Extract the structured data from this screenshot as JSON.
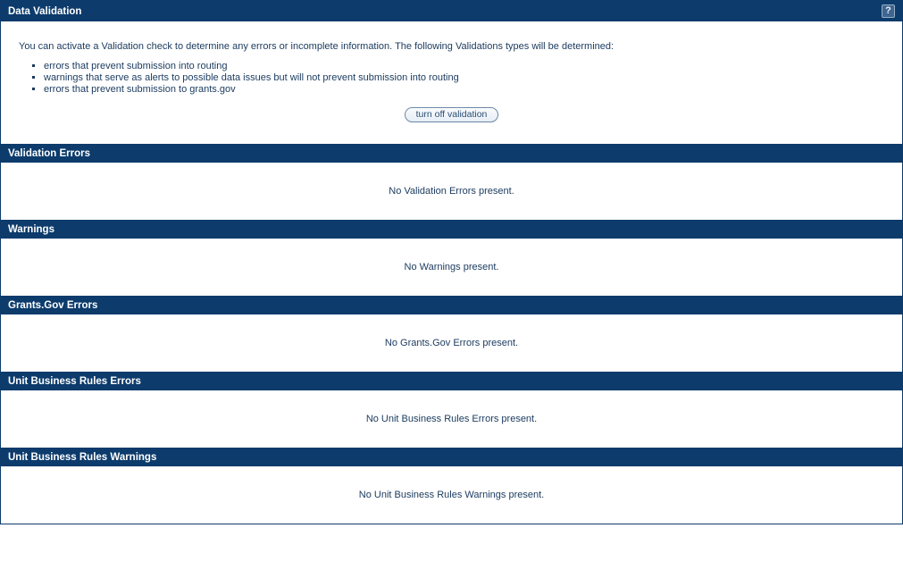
{
  "header": {
    "title": "Data Validation"
  },
  "intro": {
    "paragraph": "You can activate a Validation check to determine any errors or incomplete information. The following Validations types will be determined:",
    "bullets": [
      "errors that prevent submission into routing",
      "warnings that serve as alerts to possible data issues but will not prevent submission into routing",
      "errors that prevent submission to grants.gov"
    ],
    "toggle_label": "turn off validation"
  },
  "sections": [
    {
      "title": "Validation Errors",
      "message": "No Validation Errors present."
    },
    {
      "title": "Warnings",
      "message": "No Warnings present."
    },
    {
      "title": "Grants.Gov Errors",
      "message": "No Grants.Gov Errors present."
    },
    {
      "title": "Unit Business Rules Errors",
      "message": "No Unit Business Rules Errors present."
    },
    {
      "title": "Unit Business Rules Warnings",
      "message": "No Unit Business Rules Warnings present."
    }
  ]
}
